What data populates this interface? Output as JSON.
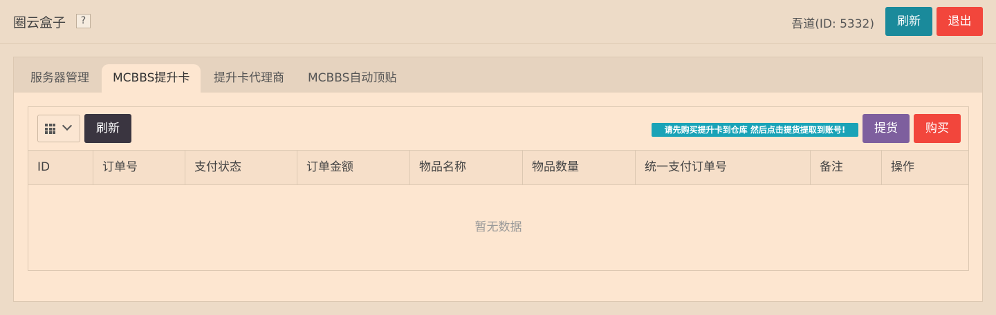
{
  "header": {
    "app_title": "圈云盒子",
    "help_label": "?",
    "user": "吾道(ID: 5332)",
    "refresh_label": "刷新",
    "logout_label": "退出"
  },
  "tabs": [
    {
      "label": "服务器管理"
    },
    {
      "label": "MCBBS提升卡"
    },
    {
      "label": "提升卡代理商"
    },
    {
      "label": "MCBBS自动顶贴"
    }
  ],
  "toolbar": {
    "refresh_label": "刷新",
    "notice": "请先购买提升卡到仓库 然后点击提货提取到账号!",
    "pickup_label": "提货",
    "buy_label": "购买"
  },
  "table": {
    "columns": [
      "ID",
      "订单号",
      "支付状态",
      "订单金额",
      "物品名称",
      "物品数量",
      "统一支付订单号",
      "备注",
      "操作"
    ],
    "empty_text": "暂无数据"
  },
  "colors": {
    "background": "#eddbc7",
    "panel": "#fde6d0",
    "teal": "#1a8a9b",
    "red": "#f2463c",
    "purple": "#7e5f9e",
    "dark": "#3a3540"
  }
}
